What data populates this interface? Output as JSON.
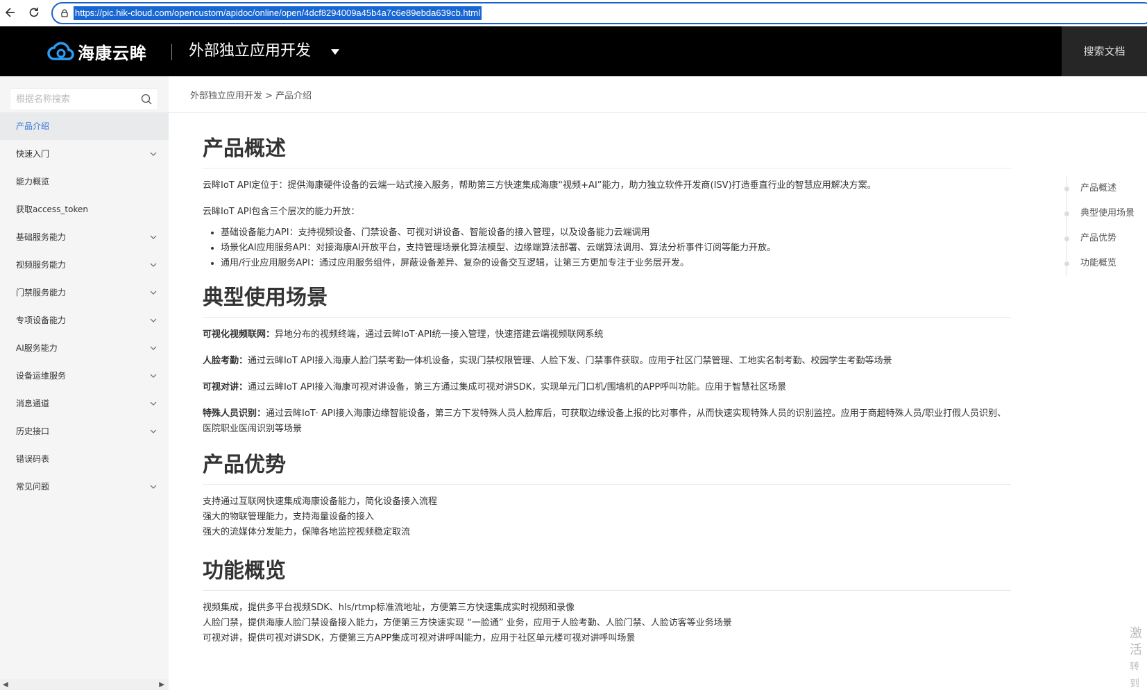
{
  "browser": {
    "url": "https://pic.hik-cloud.com/opencustom/apidoc/online/open/4dcf8294009a45b4a7c6e89ebda639cb.html"
  },
  "header": {
    "logo_text": "海康云眸",
    "app_title": "外部独立应用开发",
    "search_docs": "搜索文档"
  },
  "sidebar": {
    "search_placeholder": "根据名称搜索",
    "items": [
      {
        "label": "产品介绍",
        "active": true,
        "expandable": false
      },
      {
        "label": "快速入门",
        "expandable": true
      },
      {
        "label": "能力概览",
        "expandable": false
      },
      {
        "label": "获取access_token",
        "expandable": false
      },
      {
        "label": "基础服务能力",
        "expandable": true
      },
      {
        "label": "视频服务能力",
        "expandable": true
      },
      {
        "label": "门禁服务能力",
        "expandable": true
      },
      {
        "label": "专项设备能力",
        "expandable": true
      },
      {
        "label": "AI服务能力",
        "expandable": true
      },
      {
        "label": "设备运维服务",
        "expandable": true
      },
      {
        "label": "消息通道",
        "expandable": true
      },
      {
        "label": "历史接口",
        "expandable": true
      },
      {
        "label": "错误码表",
        "expandable": false
      },
      {
        "label": "常见问题",
        "expandable": true
      }
    ]
  },
  "breadcrumb": "外部独立应用开发 > 产品介绍",
  "sections": {
    "overview": {
      "title": "产品概述",
      "p1": "云眸IoT API定位于：提供海康硬件设备的云端一站式接入服务，帮助第三方快速集成海康“视频+AI”能力，助力独立软件开发商(ISV)打造垂直行业的智慧应用解决方案。",
      "p2": "云眸IoT API包含三个层次的能力开放：",
      "bullets": [
        "基础设备能力API：支持视频设备、门禁设备、可视对讲设备、智能设备的接入管理，以及设备能力云端调用",
        "场景化AI应用服务API：对接海康AI开放平台，支持管理场景化算法模型、边缘端算法部署、云端算法调用、算法分析事件订阅等能力开放。",
        "通用/行业应用服务API：通过应用服务组件，屏蔽设备差异、复杂的设备交互逻辑，让第三方更加专注于业务层开发。"
      ]
    },
    "scenarios": {
      "title": "典型使用场景",
      "items": [
        {
          "label": "可视化视频联网：",
          "text": "异地分布的视频终端，通过云眸IoT·API统一接入管理，快速搭建云端视频联网系统"
        },
        {
          "label": "人脸考勤：",
          "text": "通过云眸IoT API接入海康人脸门禁考勤一体机设备，实现门禁权限管理、人脸下发、门禁事件获取。应用于社区门禁管理、工地实名制考勤、校园学生考勤等场景"
        },
        {
          "label": "可视对讲：",
          "text": "通过云眸IoT API接入海康可视对讲设备，第三方通过集成可视对讲SDK，实现单元门口机/围墙机的APP呼叫功能。应用于智慧社区场景"
        },
        {
          "label": "特殊人员识别：",
          "text": "通过云眸IoT· API接入海康边缘智能设备，第三方下发特殊人员人脸库后，可获取边缘设备上报的比对事件，从而快速实现特殊人员的识别监控。应用于商超特殊人员/职业打假人员识别、医院职业医闹识别等场景"
        }
      ]
    },
    "advantages": {
      "title": "产品优势",
      "lines": [
        "支持通过互联网快速集成海康设备能力，简化设备接入流程",
        "强大的物联管理能力，支持海量设备的接入",
        "强大的流媒体分发能力，保障各地监控视频稳定取流"
      ]
    },
    "features": {
      "title": "功能概览",
      "lines": [
        "视频集成，提供多平台视频SDK、hls/rtmp标准流地址，方便第三方快速集成实时视频和录像",
        "人脸门禁，提供海康人脸门禁设备接入能力，方便第三方快速实现 “一脸通” 业务，应用于人脸考勤、人脸门禁、人脸访客等业务场景",
        "可视对讲，提供可视对讲SDK，方便第三方APP集成可视对讲呼叫能力，应用于社区单元楼可视对讲呼叫场景"
      ]
    }
  },
  "toc": [
    "产品概述",
    "典型使用场景",
    "产品优势",
    "功能概览"
  ],
  "watermark": [
    "激活",
    "转到"
  ],
  "colors": {
    "accent": "#3878d6",
    "header_bg": "#000000",
    "url_highlight": "#1967d2"
  }
}
